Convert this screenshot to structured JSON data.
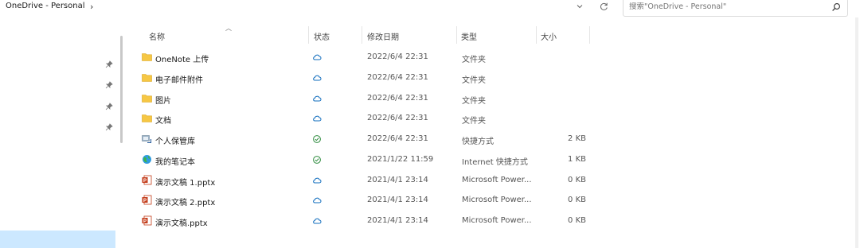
{
  "address": {
    "breadcrumb": "OneDrive - Personal",
    "chevron": "›"
  },
  "search": {
    "placeholder": "搜索\"OneDrive - Personal\""
  },
  "columns": {
    "name": "名称",
    "status": "状态",
    "date": "修改日期",
    "type": "类型",
    "size": "大小"
  },
  "rows": [
    {
      "name": "OneNote 上传",
      "icon": "folder-icon",
      "status": "cloud",
      "date": "2022/6/4 22:31",
      "type": "文件夹",
      "size": ""
    },
    {
      "name": "电子邮件附件",
      "icon": "folder-icon",
      "status": "cloud",
      "date": "2022/6/4 22:31",
      "type": "文件夹",
      "size": ""
    },
    {
      "name": "图片",
      "icon": "folder-icon",
      "status": "cloud",
      "date": "2022/6/4 22:31",
      "type": "文件夹",
      "size": ""
    },
    {
      "name": "文档",
      "icon": "folder-icon",
      "status": "cloud",
      "date": "2022/6/4 22:31",
      "type": "文件夹",
      "size": ""
    },
    {
      "name": "个人保管库",
      "icon": "shortcut-icon",
      "status": "synced",
      "date": "2022/6/4 22:31",
      "type": "快捷方式",
      "size": "2 KB"
    },
    {
      "name": "我的笔记本",
      "icon": "internet-shortcut-icon",
      "status": "synced",
      "date": "2021/1/22 11:59",
      "type": "Internet 快捷方式",
      "size": "1 KB"
    },
    {
      "name": "演示文稿 1.pptx",
      "icon": "pptx-icon",
      "status": "cloud",
      "date": "2021/4/1 23:14",
      "type": "Microsoft Power...",
      "size": "0 KB"
    },
    {
      "name": "演示文稿 2.pptx",
      "icon": "pptx-icon",
      "status": "cloud",
      "date": "2021/4/1 23:14",
      "type": "Microsoft Power...",
      "size": "0 KB"
    },
    {
      "name": "演示文稿.pptx",
      "icon": "pptx-icon",
      "status": "cloud",
      "date": "2021/4/1 23:14",
      "type": "Microsoft Power...",
      "size": "0 KB"
    }
  ],
  "colors": {
    "folder": "#f6c744",
    "cloud": "#0f6cbd",
    "synced": "#2e8b3e",
    "pptx": "#c43e1c",
    "selection": "#cce8ff"
  }
}
